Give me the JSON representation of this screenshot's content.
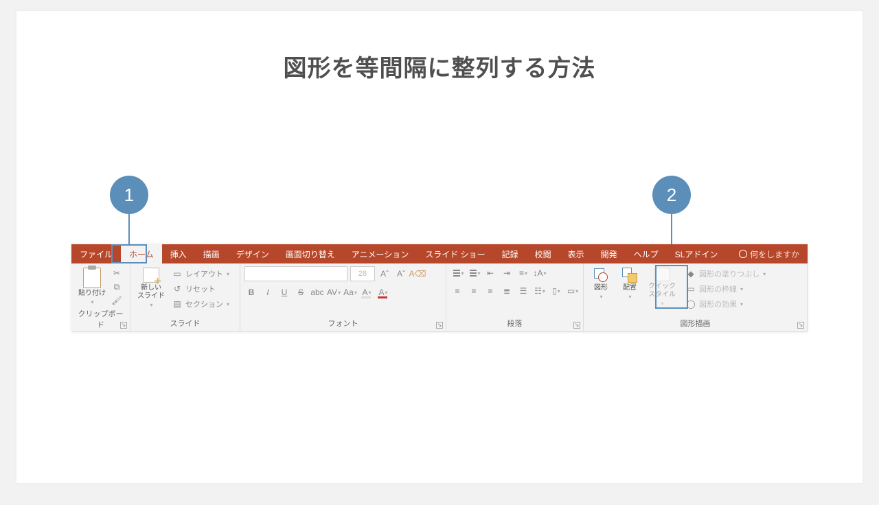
{
  "title": "図形を等間隔に整列する方法",
  "callouts": {
    "one": "1",
    "two": "2"
  },
  "tabs": {
    "file": "ファイル",
    "home": "ホーム",
    "insert": "挿入",
    "draw": "描画",
    "design": "デザイン",
    "transitions": "画面切り替え",
    "animations": "アニメーション",
    "slideshow": "スライド ショー",
    "record": "記録",
    "review": "校閲",
    "view": "表示",
    "developer": "開発",
    "help": "ヘルプ",
    "addin": "SLアドイン",
    "tellme": "何をしますか"
  },
  "clipboard": {
    "paste": "貼り付け",
    "label": "クリップボード"
  },
  "slides": {
    "newslide": "新しい\nスライド",
    "layout": "レイアウト",
    "reset": "リセット",
    "section": "セクション",
    "label": "スライド"
  },
  "font": {
    "size": "28",
    "bold": "B",
    "italic": "I",
    "underline": "U",
    "strike": "S",
    "shadow": "abc",
    "spacing": "AV",
    "case": "Aa",
    "clear": "A",
    "grow": "A",
    "shrink": "A",
    "label": "フォント"
  },
  "para": {
    "label": "段落"
  },
  "drawing": {
    "shapes": "図形",
    "arrange": "配置",
    "quick": "クイック\nスタイル",
    "fill": "図形の塗りつぶし",
    "outline": "図形の枠線",
    "effects": "図形の効果",
    "label": "図形描画"
  }
}
